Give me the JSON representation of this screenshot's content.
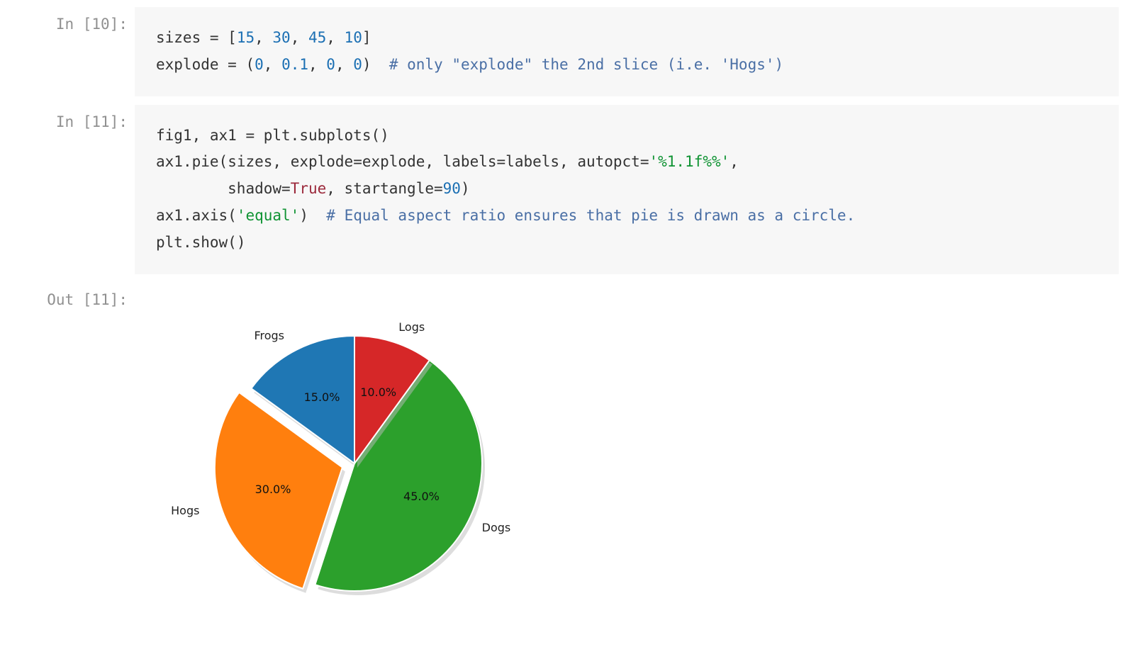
{
  "cells": {
    "c10": {
      "prompt": "In [10]:",
      "code": {
        "l1_a": "sizes ",
        "l1_eq": "= ",
        "l1_br1": "[",
        "l1_n1": "15",
        "l1_c1": ", ",
        "l1_n2": "30",
        "l1_c2": ", ",
        "l1_n3": "45",
        "l1_c3": ", ",
        "l1_n4": "10",
        "l1_br2": "]",
        "l2_a": "explode ",
        "l2_eq": "= ",
        "l2_p1": "(",
        "l2_n1": "0",
        "l2_c1": ", ",
        "l2_n2": "0.1",
        "l2_c2": ", ",
        "l2_n3": "0",
        "l2_c3": ", ",
        "l2_n4": "0",
        "l2_p2": ")  ",
        "l2_com": "# only \"explode\" the 2nd slice (i.e. 'Hogs')"
      }
    },
    "c11": {
      "prompt": "In [11]:",
      "code": {
        "l1": "fig1, ax1 ",
        "l1_eq": "= ",
        "l1_b": "plt",
        "l1_dot": ".",
        "l1_f": "subplots",
        "l1_p": "()",
        "l2_a": "ax1",
        "l2_dot": ".",
        "l2_f": "pie",
        "l2_p1": "(",
        "l2_arg": "sizes, explode",
        "l2_eq1": "=",
        "l2_v1": "explode, labels",
        "l2_eq2": "=",
        "l2_v2": "labels, autopct",
        "l2_eq3": "=",
        "l2_s1": "'%1.1f%%'",
        "l2_c": ",",
        "l3_pad": "        ",
        "l3_k1": "shadow",
        "l3_eq1": "=",
        "l3_b1": "True",
        "l3_c1": ", ",
        "l3_k2": "startangle",
        "l3_eq2": "=",
        "l3_n1": "90",
        "l3_p": ")",
        "l4_a": "ax1",
        "l4_dot": ".",
        "l4_f": "axis",
        "l4_p1": "(",
        "l4_s": "'equal'",
        "l4_p2": ")  ",
        "l4_com": "# Equal aspect ratio ensures that pie is drawn as a circle.",
        "l5_a": "plt",
        "l5_dot": ".",
        "l5_f": "show",
        "l5_p": "()"
      }
    },
    "out11": {
      "prompt": "Out [11]:"
    }
  },
  "chart_data": {
    "type": "pie",
    "startangle": 90,
    "direction": "counterclockwise",
    "explode": [
      0,
      0.1,
      0,
      0
    ],
    "shadow": true,
    "slices": [
      {
        "label": "Frogs",
        "value": 15,
        "pct": "15.0%",
        "color": "#1f77b4"
      },
      {
        "label": "Hogs",
        "value": 30,
        "pct": "30.0%",
        "color": "#ff7f0e"
      },
      {
        "label": "Dogs",
        "value": 45,
        "pct": "45.0%",
        "color": "#2ca02c"
      },
      {
        "label": "Logs",
        "value": 10,
        "pct": "10.0%",
        "color": "#d62728"
      }
    ]
  }
}
